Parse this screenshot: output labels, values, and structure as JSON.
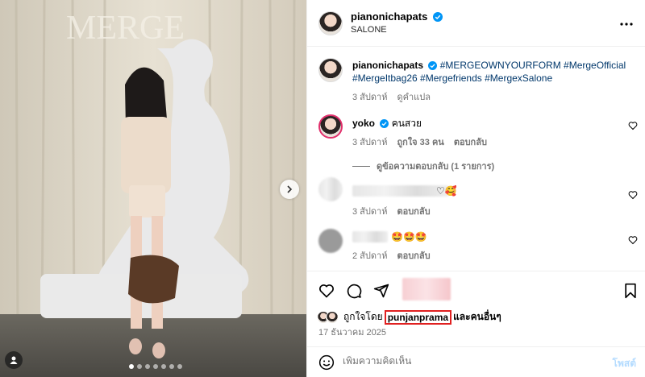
{
  "post": {
    "username": "pianonichapats",
    "location": "SALONE",
    "caption_hashtags": "#MERGEOWNYOURFORM #MergeOfficial #MergeItbag26 #Mergefriends #MergexSalone",
    "caption_time": "3 สัปดาห์",
    "caption_translate": "ดูคำแปล",
    "image_text": "MERGE"
  },
  "comments": [
    {
      "username": "yoko",
      "text": "คนสวย",
      "time": "3 สัปดาห์",
      "likes": "ถูกใจ 33 คน",
      "reply": "ตอบกลับ",
      "view_replies": "ดูข้อความตอบกลับ (1 รายการ)"
    },
    {
      "text": "♡🥰",
      "time": "3 สัปดาห์",
      "reply": "ตอบกลับ"
    },
    {
      "text": "🤩🤩🤩",
      "time": "2 สัปดาห์",
      "reply": "ตอบกลับ"
    }
  ],
  "likes": {
    "prefix": "ถูกใจโดย",
    "user": "punjanprama",
    "suffix": "และคนอื่นๆ"
  },
  "date": "17 ธันวาคม 2025",
  "composer": {
    "placeholder": "เพิ่มความคิดเห็น",
    "post_label": "โพสต์"
  },
  "colors": {
    "link": "#00376b",
    "verified": "#0095f6",
    "highlight_box": "#e02020",
    "post_button_disabled": "#b3dbff"
  }
}
